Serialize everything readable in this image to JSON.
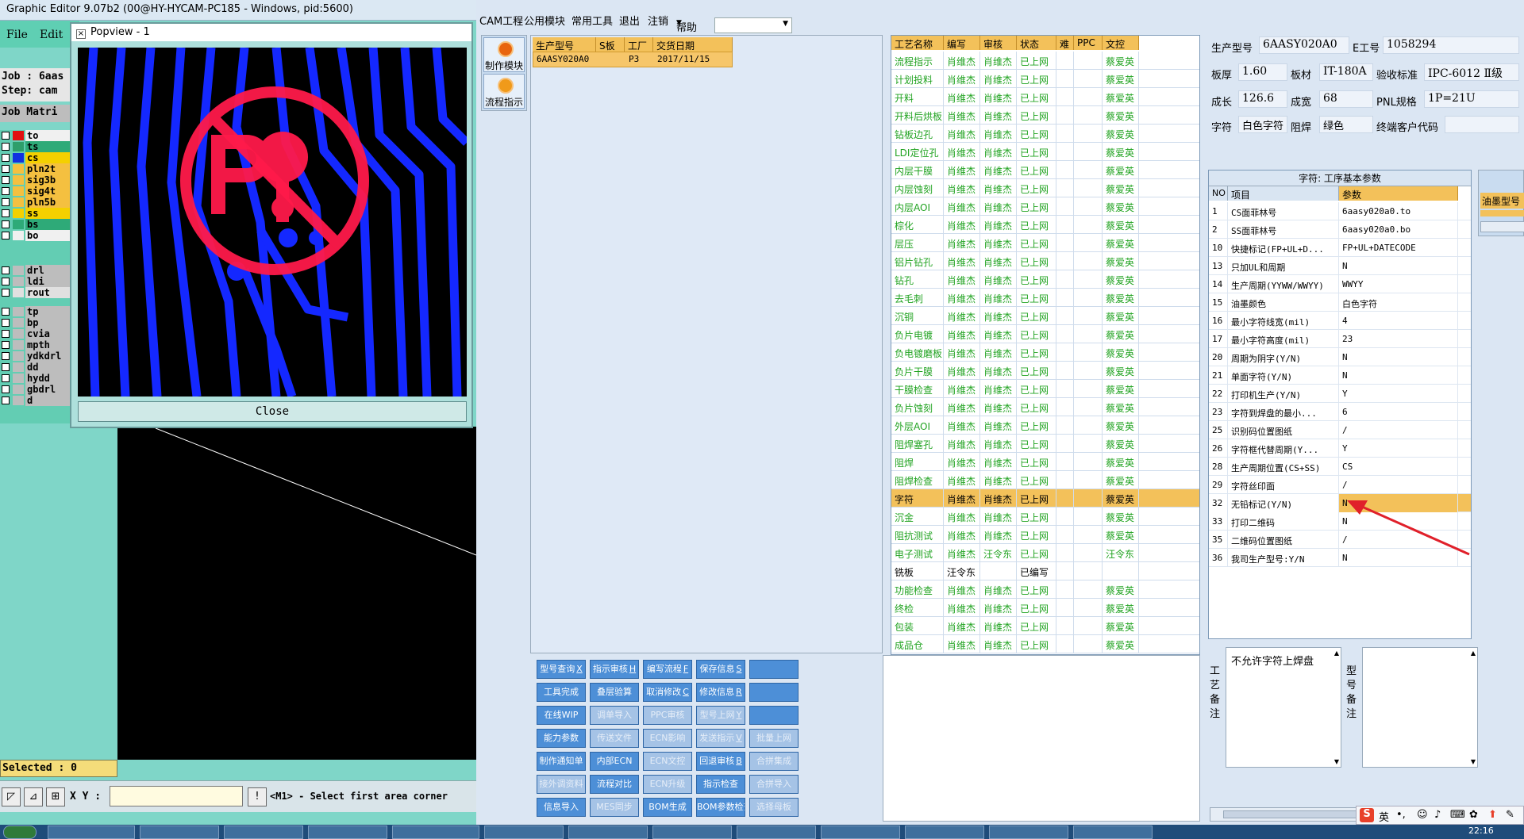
{
  "graphic_editor": {
    "title": "Graphic Editor 9.07b2 (00@HY-HYCAM-PC185 - Windows, pid:5600)",
    "menu": [
      "File",
      "Edit"
    ],
    "job_line": "Job : 6aas",
    "step_line": "Step: cam",
    "matrix_label": "Job Matri",
    "layers": [
      {
        "name": "to",
        "color": "#e01010",
        "bg": "#f0f0f0"
      },
      {
        "name": "ts",
        "color": "#2e9e6a",
        "bg": "#2eaa78"
      },
      {
        "name": "cs",
        "color": "#1030e0",
        "bg": "#f4d000"
      },
      {
        "name": "pln2t",
        "color": "",
        "bg": "#f4c040"
      },
      {
        "name": "sig3b",
        "color": "",
        "bg": "#f4c040"
      },
      {
        "name": "sig4t",
        "color": "",
        "bg": "#f4c040"
      },
      {
        "name": "pln5b",
        "color": "",
        "bg": "#f4c040"
      },
      {
        "name": "ss",
        "color": "",
        "bg": "#f4d000"
      },
      {
        "name": "bs",
        "color": "",
        "bg": "#2eaa78"
      },
      {
        "name": "bo",
        "color": "",
        "bg": "#f0f0f0"
      },
      {
        "name": "drl",
        "color": "",
        "bg": "#bdbdbd"
      },
      {
        "name": "ldi",
        "color": "",
        "bg": "#bdbdbd"
      },
      {
        "name": "rout",
        "color": "",
        "bg": "#e0e0e0"
      },
      {
        "name": "tp",
        "color": "",
        "bg": "#bdbdbd"
      },
      {
        "name": "bp",
        "color": "",
        "bg": "#bdbdbd"
      },
      {
        "name": "cvia",
        "color": "",
        "bg": "#bdbdbd"
      },
      {
        "name": "mpth",
        "color": "",
        "bg": "#bdbdbd"
      },
      {
        "name": "ydkdrl",
        "color": "",
        "bg": "#bdbdbd"
      },
      {
        "name": "dd",
        "color": "",
        "bg": "#bdbdbd"
      },
      {
        "name": "hydd",
        "color": "",
        "bg": "#bdbdbd"
      },
      {
        "name": "gbdrl",
        "color": "",
        "bg": "#bdbdbd"
      },
      {
        "name": "d",
        "color": "",
        "bg": "#bdbdbd"
      }
    ],
    "selected": "Selected : 0",
    "xy_label": "X Y :",
    "xy_value": "",
    "message": "<M1> - Select first area corner",
    "popview": {
      "title": "Popview - 1",
      "close": "Close"
    }
  },
  "cam": {
    "menu": [
      "CAM工程",
      "公用模块",
      "常用工具",
      "退出",
      "注销",
      "帮助"
    ],
    "side_buttons": [
      "制作模块",
      "流程指示"
    ],
    "order_headers": [
      "生产型号",
      "S板",
      "工厂",
      "交货日期"
    ],
    "order_rows": [
      [
        "6AASY020A0",
        "",
        "P3",
        "2017/11/15"
      ]
    ],
    "process_headers": [
      "工艺名称",
      "编写",
      "审核",
      "状态",
      "难",
      "PPC",
      "文控"
    ],
    "process_rows": [
      [
        "流程指示",
        "肖维杰",
        "肖维杰",
        "已上网",
        "",
        "",
        "蔡爱英"
      ],
      [
        "计划投料",
        "肖维杰",
        "肖维杰",
        "已上网",
        "",
        "",
        "蔡爱英"
      ],
      [
        "开料",
        "肖维杰",
        "肖维杰",
        "已上网",
        "",
        "",
        "蔡爱英"
      ],
      [
        "开料后烘板",
        "肖维杰",
        "肖维杰",
        "已上网",
        "",
        "",
        "蔡爱英"
      ],
      [
        "钻板边孔",
        "肖维杰",
        "肖维杰",
        "已上网",
        "",
        "",
        "蔡爱英"
      ],
      [
        "LDI定位孔",
        "肖维杰",
        "肖维杰",
        "已上网",
        "",
        "",
        "蔡爱英"
      ],
      [
        "内层干膜",
        "肖维杰",
        "肖维杰",
        "已上网",
        "",
        "",
        "蔡爱英"
      ],
      [
        "内层蚀刻",
        "肖维杰",
        "肖维杰",
        "已上网",
        "",
        "",
        "蔡爱英"
      ],
      [
        "内层AOI",
        "肖维杰",
        "肖维杰",
        "已上网",
        "",
        "",
        "蔡爱英"
      ],
      [
        "棕化",
        "肖维杰",
        "肖维杰",
        "已上网",
        "",
        "",
        "蔡爱英"
      ],
      [
        "层压",
        "肖维杰",
        "肖维杰",
        "已上网",
        "",
        "",
        "蔡爱英"
      ],
      [
        "铝片钻孔",
        "肖维杰",
        "肖维杰",
        "已上网",
        "",
        "",
        "蔡爱英"
      ],
      [
        "钻孔",
        "肖维杰",
        "肖维杰",
        "已上网",
        "",
        "",
        "蔡爱英"
      ],
      [
        "去毛刺",
        "肖维杰",
        "肖维杰",
        "已上网",
        "",
        "",
        "蔡爱英"
      ],
      [
        "沉铜",
        "肖维杰",
        "肖维杰",
        "已上网",
        "",
        "",
        "蔡爱英"
      ],
      [
        "负片电镀",
        "肖维杰",
        "肖维杰",
        "已上网",
        "",
        "",
        "蔡爱英"
      ],
      [
        "负电镀磨板",
        "肖维杰",
        "肖维杰",
        "已上网",
        "",
        "",
        "蔡爱英"
      ],
      [
        "负片干膜",
        "肖维杰",
        "肖维杰",
        "已上网",
        "",
        "",
        "蔡爱英"
      ],
      [
        "干膜检查",
        "肖维杰",
        "肖维杰",
        "已上网",
        "",
        "",
        "蔡爱英"
      ],
      [
        "负片蚀刻",
        "肖维杰",
        "肖维杰",
        "已上网",
        "",
        "",
        "蔡爱英"
      ],
      [
        "外层AOI",
        "肖维杰",
        "肖维杰",
        "已上网",
        "",
        "",
        "蔡爱英"
      ],
      [
        "阻焊塞孔",
        "肖维杰",
        "肖维杰",
        "已上网",
        "",
        "",
        "蔡爱英"
      ],
      [
        "阻焊",
        "肖维杰",
        "肖维杰",
        "已上网",
        "",
        "",
        "蔡爱英"
      ],
      [
        "阻焊检查",
        "肖维杰",
        "肖维杰",
        "已上网",
        "",
        "",
        "蔡爱英"
      ],
      [
        "字符",
        "肖维杰",
        "肖维杰",
        "已上网",
        "",
        "",
        "蔡爱英"
      ],
      [
        "沉金",
        "肖维杰",
        "肖维杰",
        "已上网",
        "",
        "",
        "蔡爱英"
      ],
      [
        "阻抗测试",
        "肖维杰",
        "肖维杰",
        "已上网",
        "",
        "",
        "蔡爱英"
      ],
      [
        "电子测试",
        "肖维杰",
        "汪令东",
        "已上网",
        "",
        "",
        "汪令东"
      ],
      [
        "铣板",
        "汪令东",
        "",
        "已编写",
        "",
        "",
        ""
      ],
      [
        "功能检查",
        "肖维杰",
        "肖维杰",
        "已上网",
        "",
        "",
        "蔡爱英"
      ],
      [
        "终检",
        "肖维杰",
        "肖维杰",
        "已上网",
        "",
        "",
        "蔡爱英"
      ],
      [
        "包装",
        "肖维杰",
        "肖维杰",
        "已上网",
        "",
        "",
        "蔡爱英"
      ],
      [
        "成品仓",
        "肖维杰",
        "肖维杰",
        "已上网",
        "",
        "",
        "蔡爱英"
      ]
    ],
    "selected_process": "字符",
    "buttons": [
      [
        {
          "l": "型号查询",
          "k": "X",
          "d": false
        },
        {
          "l": "指示审核",
          "k": "H",
          "d": false
        },
        {
          "l": "编写流程",
          "k": "F",
          "d": false
        },
        {
          "l": "保存信息",
          "k": "S",
          "d": false
        },
        {
          "l": "",
          "k": "",
          "d": false
        }
      ],
      [
        {
          "l": "工具完成",
          "k": "",
          "d": false
        },
        {
          "l": "叠层验算",
          "k": "",
          "d": false
        },
        {
          "l": "取消修改",
          "k": "C",
          "d": false
        },
        {
          "l": "修改信息",
          "k": "R",
          "d": false
        },
        {
          "l": "",
          "k": "",
          "d": false
        }
      ],
      [
        {
          "l": "在线WIP",
          "k": "",
          "d": false
        },
        {
          "l": "调单导入",
          "k": "",
          "d": true
        },
        {
          "l": "PPC审核",
          "k": "",
          "d": true
        },
        {
          "l": "型号上网",
          "k": "Y",
          "d": true
        },
        {
          "l": "",
          "k": "",
          "d": false
        }
      ],
      [
        {
          "l": "能力参数",
          "k": "",
          "d": false
        },
        {
          "l": "传送文件",
          "k": "",
          "d": true
        },
        {
          "l": "ECN影响",
          "k": "",
          "d": true
        },
        {
          "l": "发送指示",
          "k": "V",
          "d": true
        },
        {
          "l": "批量上网",
          "k": "",
          "d": true
        }
      ],
      [
        {
          "l": "制作通知单",
          "k": "",
          "d": false
        },
        {
          "l": "内部ECN",
          "k": "",
          "d": false
        },
        {
          "l": "ECN文控",
          "k": "",
          "d": true
        },
        {
          "l": "回退审核",
          "k": "B",
          "d": false
        },
        {
          "l": "合拼集成",
          "k": "",
          "d": true
        }
      ],
      [
        {
          "l": "接外调资料",
          "k": "",
          "d": true
        },
        {
          "l": "流程对比",
          "k": "",
          "d": false
        },
        {
          "l": "ECN升级",
          "k": "",
          "d": true
        },
        {
          "l": "指示检查",
          "k": "",
          "d": false
        },
        {
          "l": "合拼导入",
          "k": "",
          "d": true
        }
      ],
      [
        {
          "l": "信息导入",
          "k": "",
          "d": false
        },
        {
          "l": "MES同步",
          "k": "",
          "d": true
        },
        {
          "l": "BOM生成",
          "k": "",
          "d": false
        },
        {
          "l": "BOM参数检查",
          "k": "",
          "d": false
        },
        {
          "l": "选择母板",
          "k": "",
          "d": true
        }
      ]
    ],
    "info": {
      "model_label": "生产型号",
      "model": "6AASY020A0",
      "eng_label": "E工号",
      "eng": "1058294",
      "thick_label": "板厚",
      "thick": "1.60",
      "mat_label": "板材",
      "mat": "IT-180A",
      "std_label": "验收标准",
      "std": "IPC-6012 Ⅱ级",
      "len_label": "成长",
      "len": "126.6",
      "wid_label": "成宽",
      "wid": "68",
      "pnl_label": "PNL规格",
      "pnl": "1P=21U",
      "char_label": "字符",
      "char": "白色字符",
      "mask_label": "阻焊",
      "mask": "绿色",
      "cust_label": "终端客户代码",
      "cust": ""
    },
    "params_title": "字符: 工序基本参数",
    "params_headers": [
      "NO",
      "项目",
      "参数"
    ],
    "params_rows": [
      [
        "1",
        "CS面菲林号",
        "6aasy020a0.to"
      ],
      [
        "2",
        "SS面菲林号",
        "6aasy020a0.bo"
      ],
      [
        "10",
        "快捷标记(FP+UL+D...",
        "FP+UL+DATECODE"
      ],
      [
        "13",
        "只加UL和周期",
        "N"
      ],
      [
        "14",
        "生产周期(YYWW/WWYY)",
        "WWYY"
      ],
      [
        "15",
        "油墨颜色",
        "白色字符"
      ],
      [
        "16",
        "最小字符线宽(mil)",
        "4"
      ],
      [
        "17",
        "最小字符高度(mil)",
        "23"
      ],
      [
        "20",
        "周期为阴字(Y/N)",
        "N"
      ],
      [
        "21",
        "单面字符(Y/N)",
        "N"
      ],
      [
        "22",
        "打印机生产(Y/N)",
        "Y"
      ],
      [
        "23",
        "字符到焊盘的最小...",
        "6"
      ],
      [
        "25",
        "识别码位置图纸",
        "/"
      ],
      [
        "26",
        "字符框代替周期(Y...",
        "Y"
      ],
      [
        "28",
        "生产周期位置(CS+SS)",
        "CS"
      ],
      [
        "29",
        "字符丝印面",
        "/"
      ],
      [
        "32",
        "无铅标记(Y/N)",
        "N"
      ],
      [
        "33",
        "打印二维码",
        "N"
      ],
      [
        "35",
        "二维码位置图纸",
        "/"
      ],
      [
        "36",
        "我司生产型号:Y/N",
        "N"
      ]
    ],
    "selected_param": "32",
    "oil_header": "油墨型号",
    "notes": {
      "process_label": "工艺备注",
      "process_text": "不允许字符上焊盘",
      "model_label": "型号备注",
      "model_text": ""
    },
    "ime": {
      "logo": "S",
      "lang": "英"
    }
  },
  "taskbar": {
    "clock": "22:16"
  },
  "colors": {
    "accent_orange": "#f3c15a",
    "button_blue": "#4d8fd7",
    "ok_green": "#21a321",
    "arrow_red": "#e0202a"
  }
}
